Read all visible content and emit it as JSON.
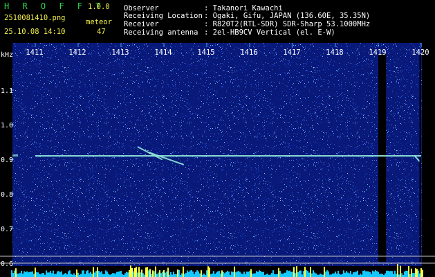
{
  "header": {
    "app_title": "H R O F F T",
    "version": "1.0.0",
    "filename": "2510081410.png",
    "datetime": "25.10.08 14:10",
    "count_label": "meteor",
    "count_value": "47",
    "fields": [
      {
        "label": "Observer",
        "value": ": Takanori Kawachi"
      },
      {
        "label": "Receiving Location",
        "value": ": Ogaki, Gifu, JAPAN (136.60E, 35.35N)"
      },
      {
        "label": "Receiver",
        "value": ": R820T2(RTL-SDR) SDR-Sharp 53.1000MHz"
      },
      {
        "label": "Receiving antenna",
        "value": ": 2el-HB9CV Vertical (el. E-W)"
      }
    ]
  },
  "colors": {
    "background": "#08197a",
    "noise": "#6fb6ff",
    "signal": "#8fe8d8",
    "header_green": "#2fd84a",
    "header_yellow": "#f2f04a",
    "grid": "#4da0ff",
    "axis_text": "#ffffff",
    "gap": "#000000",
    "bottom_bar": "#15c8ff",
    "bottom_peak": "#ffff40"
  },
  "chart_data": {
    "type": "heatmap",
    "ylabel": "kHz",
    "x_ticks": [
      "1411",
      "1412",
      "1413",
      "1414",
      "1415",
      "1416",
      "1417",
      "1418",
      "1419",
      "1420"
    ],
    "y_ticks": [
      "1.1",
      "1.0",
      "0.9",
      "0.8",
      "0.7",
      "0.6"
    ],
    "xlim": [
      1410.5,
      1420.0
    ],
    "ylim": [
      0.6,
      1.2
    ],
    "carrier_frequency_khz": 0.91,
    "carrier_extent": [
      1411.0,
      1420.0
    ],
    "meteor_echoes": [
      {
        "t_start": 1413.4,
        "f_start": 0.935,
        "t_end": 1413.95,
        "f_end": 0.9
      },
      {
        "t_start": 1413.65,
        "f_start": 0.92,
        "t_end": 1414.45,
        "f_end": 0.885
      },
      {
        "t_start": 1419.85,
        "f_start": 0.91,
        "t_end": 1419.95,
        "f_end": 0.895
      }
    ],
    "data_gaps": [
      {
        "start": 1419.0,
        "end": 1419.18
      },
      {
        "start": 1419.96,
        "end": 1420.0
      }
    ]
  }
}
